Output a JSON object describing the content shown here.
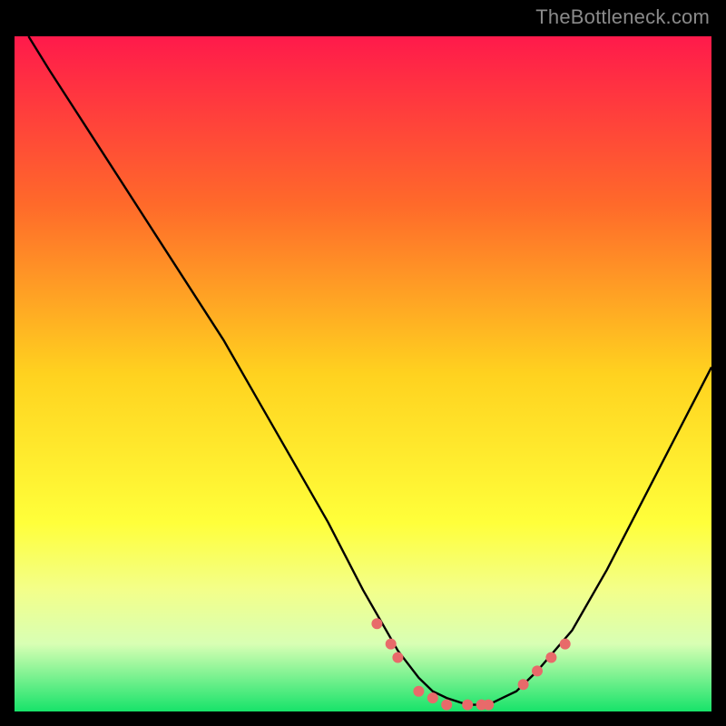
{
  "watermark": "TheBottleneck.com",
  "chart_data": {
    "type": "line",
    "title": "",
    "xlabel": "",
    "ylabel": "",
    "xlim": [
      0,
      100
    ],
    "ylim": [
      0,
      100
    ],
    "grid": false,
    "legend": false,
    "gradient_stops": [
      {
        "offset": 0,
        "color": "#ff1a4b"
      },
      {
        "offset": 0.25,
        "color": "#ff6a2a"
      },
      {
        "offset": 0.5,
        "color": "#ffd21f"
      },
      {
        "offset": 0.72,
        "color": "#ffff3a"
      },
      {
        "offset": 0.82,
        "color": "#f3ff8a"
      },
      {
        "offset": 0.9,
        "color": "#d8ffb4"
      },
      {
        "offset": 1.0,
        "color": "#17e36a"
      }
    ],
    "series": [
      {
        "name": "bottleneck-curve",
        "color": "#000000",
        "x": [
          2,
          5,
          10,
          15,
          20,
          25,
          30,
          35,
          40,
          45,
          50,
          55,
          58,
          60,
          62,
          65,
          68,
          70,
          72,
          75,
          80,
          85,
          90,
          95,
          100
        ],
        "y": [
          100,
          95,
          87,
          79,
          71,
          63,
          55,
          46,
          37,
          28,
          18,
          9,
          5,
          3,
          2,
          1,
          1,
          2,
          3,
          6,
          12,
          21,
          31,
          41,
          51
        ]
      }
    ],
    "markers": {
      "name": "highlight-dots",
      "color": "#e86a6a",
      "radius_px": 6,
      "x": [
        52,
        54,
        55,
        58,
        60,
        62,
        65,
        67,
        68,
        73,
        75,
        77,
        79
      ],
      "y": [
        13,
        10,
        8,
        3,
        2,
        1,
        1,
        1,
        1,
        4,
        6,
        8,
        10
      ]
    }
  }
}
